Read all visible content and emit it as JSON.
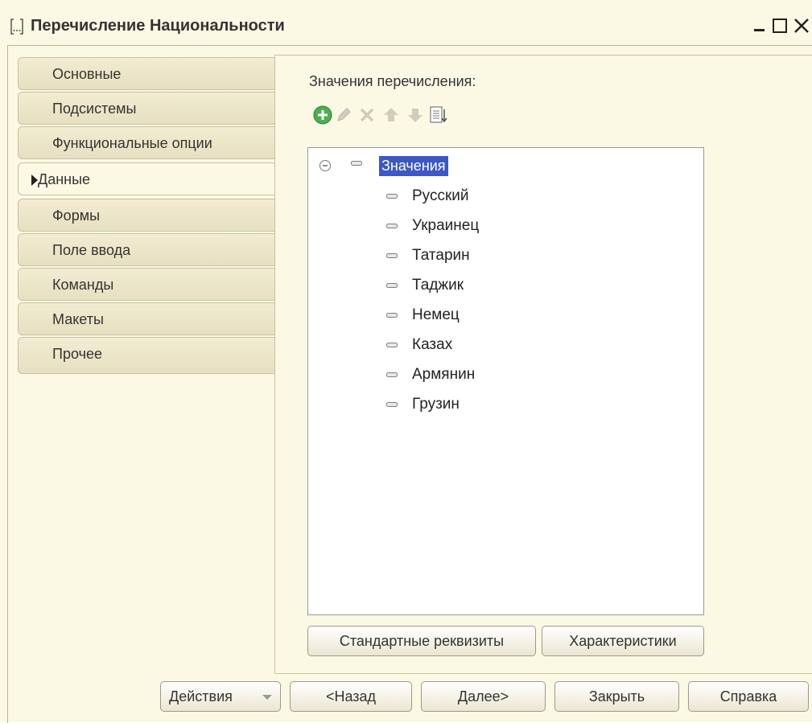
{
  "window": {
    "title": "Перечисление Национальности"
  },
  "tabs": [
    {
      "label": "Основные",
      "active": false
    },
    {
      "label": "Подсистемы",
      "active": false
    },
    {
      "label": "Функциональные опции",
      "active": false
    },
    {
      "label": "Данные",
      "active": true
    },
    {
      "label": "Формы",
      "active": false
    },
    {
      "label": "Поле ввода",
      "active": false
    },
    {
      "label": "Команды",
      "active": false
    },
    {
      "label": "Макеты",
      "active": false
    },
    {
      "label": "Прочее",
      "active": false
    }
  ],
  "values_panel": {
    "label": "Значения перечисления:",
    "toolbar": [
      "add-icon",
      "edit-icon",
      "delete-icon",
      "move-up-icon",
      "move-down-icon",
      "sort-icon"
    ],
    "tree": {
      "root": "Значения",
      "items": [
        "Русский",
        "Украинец",
        "Татарин",
        "Таджик",
        "Немец",
        "Казах",
        "Армянин",
        "Грузин"
      ]
    },
    "buttons": {
      "standard_attributes": "Стандартные реквизиты",
      "characteristics": "Характеристики"
    }
  },
  "footer": {
    "actions": "Действия",
    "back": "<Назад",
    "next": "Далее>",
    "close": "Закрыть",
    "help": "Справка"
  },
  "colors": {
    "background": "#fbf8e4",
    "selection": "#3d58c4",
    "add_icon": "#4caf50"
  }
}
